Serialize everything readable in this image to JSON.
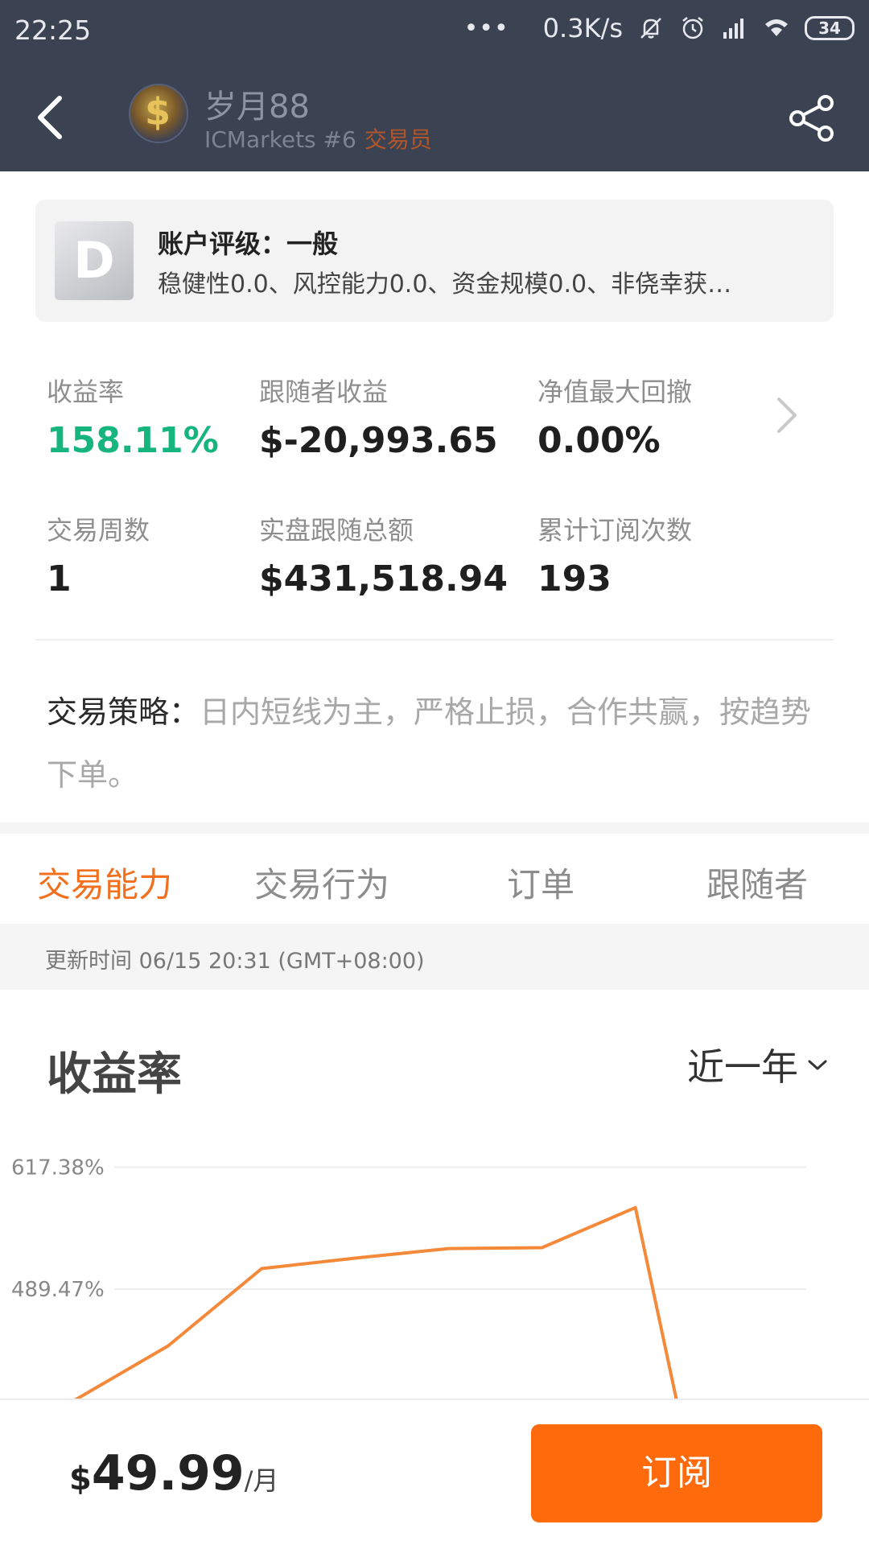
{
  "status_bar": {
    "time": "22:25",
    "dots": "•••",
    "net_speed": "0.3K/s",
    "battery": "34"
  },
  "nav": {
    "trader_name": "岁月88",
    "broker": "ICMarkets #6",
    "role": "交易员"
  },
  "rating": {
    "grade": "D",
    "title": "账户评级：一般",
    "description": "稳健性0.0、风控能力0.0、资金规模0.0、非侥幸获…"
  },
  "stats": [
    {
      "label": "收益率",
      "value": "158.11%"
    },
    {
      "label": "跟随者收益",
      "value": "$-20,993.65"
    },
    {
      "label": "净值最大回撤",
      "value": "0.00%"
    },
    {
      "label": "交易周数",
      "value": "1"
    },
    {
      "label": "实盘跟随总额",
      "value": "$431,518.94"
    },
    {
      "label": "累计订阅次数",
      "value": "193"
    }
  ],
  "strategy": {
    "label": "交易策略：",
    "text": "日内短线为主，严格止损，合作共赢，按趋势下单。"
  },
  "tabs": [
    {
      "label": "交易能力",
      "active": true
    },
    {
      "label": "交易行为",
      "active": false
    },
    {
      "label": "订单",
      "active": false
    },
    {
      "label": "跟随者",
      "active": false
    }
  ],
  "update_time": "更新时间 06/15 20:31 (GMT+08:00)",
  "chart_section": {
    "title": "收益率",
    "period": "近一年"
  },
  "chart_data": {
    "type": "line",
    "ytick_labels": [
      "617.38%",
      "489.47%"
    ],
    "yticks": [
      617.38,
      489.47
    ],
    "ylim": [
      373,
      660
    ],
    "series": [
      {
        "color": "#f5893a",
        "points": [
          {
            "x": 0.0,
            "y": 373
          },
          {
            "x": 1.0,
            "y": 430
          },
          {
            "x": 2.0,
            "y": 511
          },
          {
            "x": 3.0,
            "y": 522
          },
          {
            "x": 4.0,
            "y": 532
          },
          {
            "x": 5.0,
            "y": 533
          },
          {
            "x": 6.0,
            "y": 575
          },
          {
            "x": 6.44,
            "y": 373
          }
        ]
      }
    ],
    "xlim": [
      -0.8,
      8.5
    ],
    "grid": true
  },
  "bottom": {
    "currency": "$",
    "price": "49.99",
    "unit": "/月",
    "subscribe_label": "订阅"
  },
  "colors": {
    "header_bg": "#3b4352",
    "accent": "#f26f1d",
    "positive": "#17b57e",
    "button": "#ff6a0d",
    "line": "#f5893a"
  }
}
